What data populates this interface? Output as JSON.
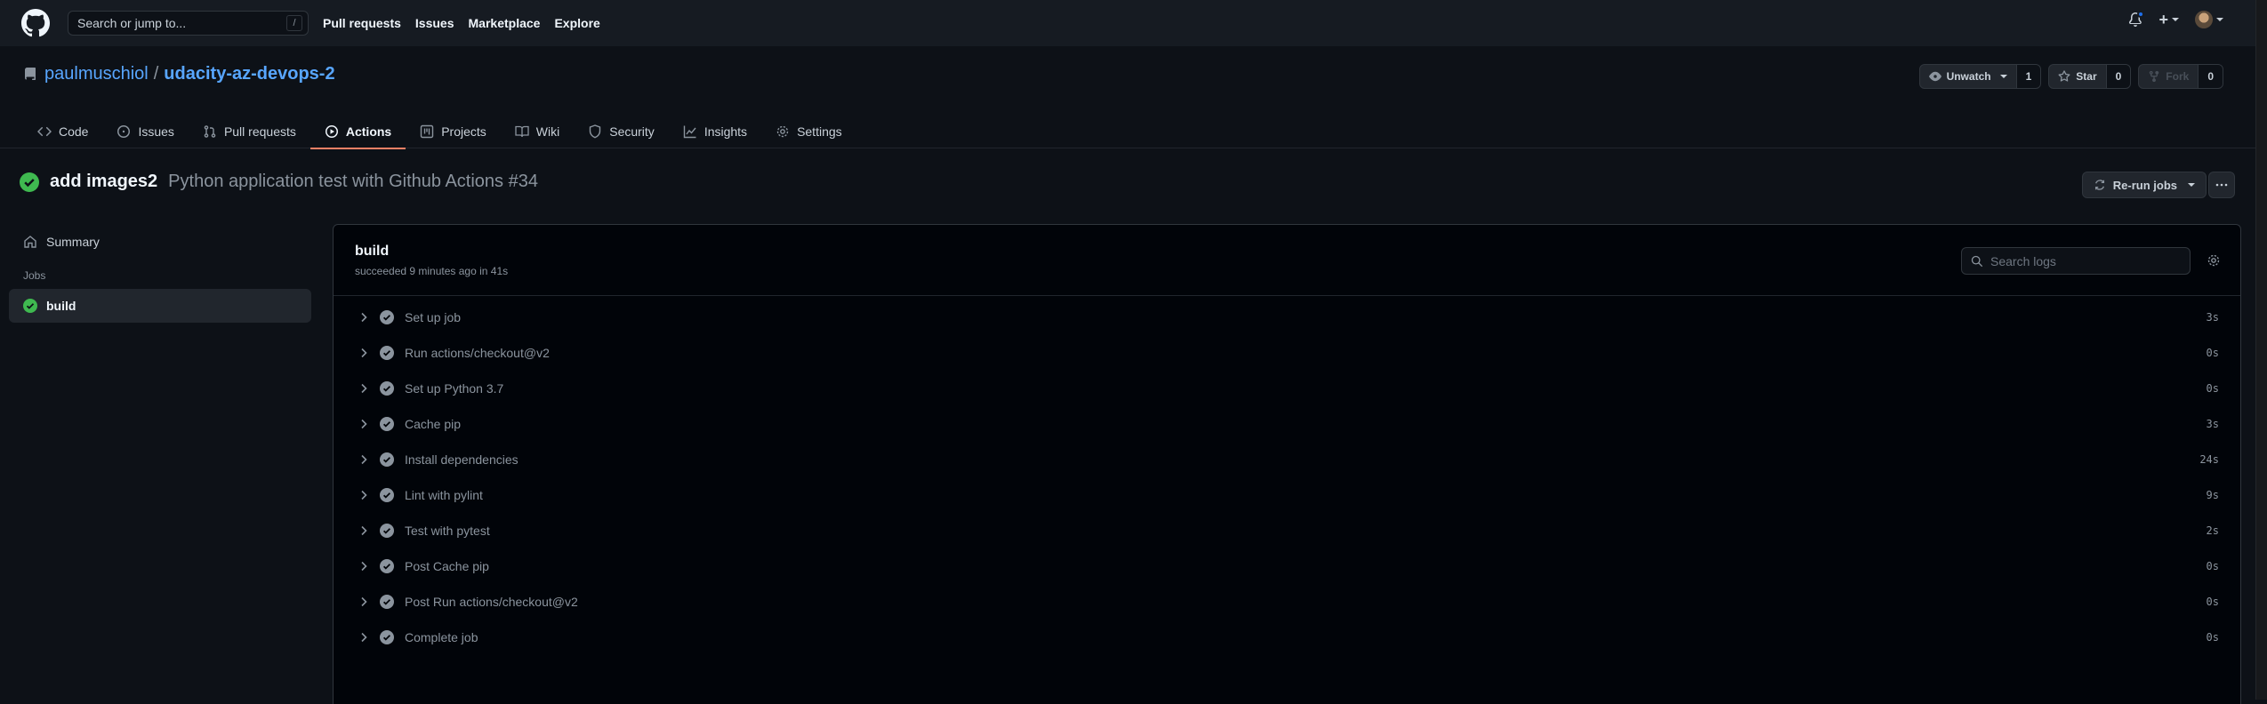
{
  "header": {
    "search_placeholder": "Search or jump to...",
    "search_kbd": "/",
    "nav": [
      "Pull requests",
      "Issues",
      "Marketplace",
      "Explore"
    ],
    "plus_icon": "+",
    "accent": "#1f6feb"
  },
  "repo": {
    "owner": "paulmuschiol",
    "separator": "/",
    "name": "udacity-az-devops-2",
    "watch_label": "Unwatch",
    "watch_count": "1",
    "star_label": "Star",
    "star_count": "0",
    "fork_label": "Fork",
    "fork_count": "0"
  },
  "tabs": [
    {
      "label": "Code",
      "icon": "code-icon"
    },
    {
      "label": "Issues",
      "icon": "issue-icon"
    },
    {
      "label": "Pull requests",
      "icon": "pull-request-icon"
    },
    {
      "label": "Actions",
      "icon": "play-icon",
      "active": true
    },
    {
      "label": "Projects",
      "icon": "project-icon"
    },
    {
      "label": "Wiki",
      "icon": "book-icon"
    },
    {
      "label": "Security",
      "icon": "shield-icon"
    },
    {
      "label": "Insights",
      "icon": "graph-icon"
    },
    {
      "label": "Settings",
      "icon": "gear-icon"
    }
  ],
  "run": {
    "commit_message": "add images2",
    "workflow": "Python application test with Github Actions #34",
    "rerun_label": "Re-run jobs",
    "success_color": "#3fb950"
  },
  "sidebar": {
    "summary_label": "Summary",
    "jobs_heading": "Jobs",
    "job_label": "build"
  },
  "job": {
    "name": "build",
    "meta": "succeeded 9 minutes ago in 41s",
    "search_placeholder": "Search logs",
    "steps": [
      {
        "name": "Set up job",
        "duration": "3s"
      },
      {
        "name": "Run actions/checkout@v2",
        "duration": "0s"
      },
      {
        "name": "Set up Python 3.7",
        "duration": "0s"
      },
      {
        "name": "Cache pip",
        "duration": "3s"
      },
      {
        "name": "Install dependencies",
        "duration": "24s"
      },
      {
        "name": "Lint with pylint",
        "duration": "9s"
      },
      {
        "name": "Test with pytest",
        "duration": "2s"
      },
      {
        "name": "Post Cache pip",
        "duration": "0s"
      },
      {
        "name": "Post Run actions/checkout@v2",
        "duration": "0s"
      },
      {
        "name": "Complete job",
        "duration": "0s"
      }
    ]
  }
}
